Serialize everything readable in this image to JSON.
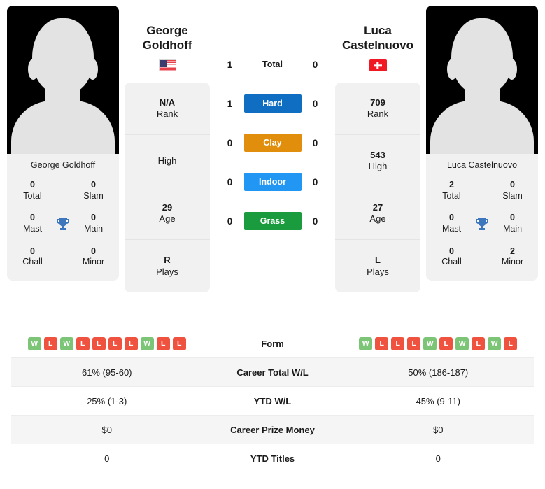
{
  "players": {
    "left": {
      "name": "George Goldhoff",
      "photo_caption": "George Goldhoff",
      "flag": "us-flag-icon",
      "rank": "N/A",
      "rank_label": "Rank",
      "high": "",
      "high_label": "High",
      "age": "29",
      "age_label": "Age",
      "plays": "R",
      "plays_label": "Plays",
      "titles": {
        "total": "0",
        "total_label": "Total",
        "slam": "0",
        "slam_label": "Slam",
        "mast": "0",
        "mast_label": "Mast",
        "main": "0",
        "main_label": "Main",
        "chall": "0",
        "chall_label": "Chall",
        "minor": "0",
        "minor_label": "Minor"
      },
      "form": [
        "W",
        "L",
        "W",
        "L",
        "L",
        "L",
        "L",
        "W",
        "L",
        "L"
      ],
      "career_total_wl": "61% (95-60)",
      "ytd_wl": "25% (1-3)",
      "career_prize_money": "$0",
      "ytd_titles": "0"
    },
    "right": {
      "name": "Luca Castelnuovo",
      "photo_caption": "Luca Castelnuovo",
      "flag": "ch-flag-icon",
      "rank": "709",
      "rank_label": "Rank",
      "high": "543",
      "high_label": "High",
      "age": "27",
      "age_label": "Age",
      "plays": "L",
      "plays_label": "Plays",
      "titles": {
        "total": "2",
        "total_label": "Total",
        "slam": "0",
        "slam_label": "Slam",
        "mast": "0",
        "mast_label": "Mast",
        "main": "0",
        "main_label": "Main",
        "chall": "0",
        "chall_label": "Chall",
        "minor": "2",
        "minor_label": "Minor"
      },
      "form": [
        "W",
        "L",
        "L",
        "L",
        "W",
        "L",
        "W",
        "L",
        "W",
        "L"
      ],
      "career_total_wl": "50% (186-187)",
      "ytd_wl": "45% (9-11)",
      "career_prize_money": "$0",
      "ytd_titles": "0"
    }
  },
  "h2h": {
    "rows": [
      {
        "label": "Total",
        "left": "1",
        "right": "0",
        "style": "plain",
        "color": ""
      },
      {
        "label": "Hard",
        "left": "1",
        "right": "0",
        "style": "badge",
        "color": "#0f6ec1"
      },
      {
        "label": "Clay",
        "left": "0",
        "right": "0",
        "style": "badge",
        "color": "#e08e0b"
      },
      {
        "label": "Indoor",
        "left": "0",
        "right": "0",
        "style": "badge",
        "color": "#2196f3"
      },
      {
        "label": "Grass",
        "left": "0",
        "right": "0",
        "style": "badge",
        "color": "#1a9c3e"
      }
    ]
  },
  "stats_table": {
    "rows": [
      {
        "label": "Form",
        "type": "form"
      },
      {
        "label": "Career Total W/L",
        "type": "text",
        "key": "career_total_wl"
      },
      {
        "label": "YTD W/L",
        "type": "text",
        "key": "ytd_wl"
      },
      {
        "label": "Career Prize Money",
        "type": "text",
        "key": "career_prize_money"
      },
      {
        "label": "YTD Titles",
        "type": "text",
        "key": "ytd_titles"
      }
    ]
  },
  "colors": {
    "hard": "#0f6ec1",
    "clay": "#e08e0b",
    "indoor": "#2196f3",
    "grass": "#1a9c3e",
    "win": "#7cc576",
    "loss": "#ef5340",
    "card_bg": "#f1f1f1"
  }
}
